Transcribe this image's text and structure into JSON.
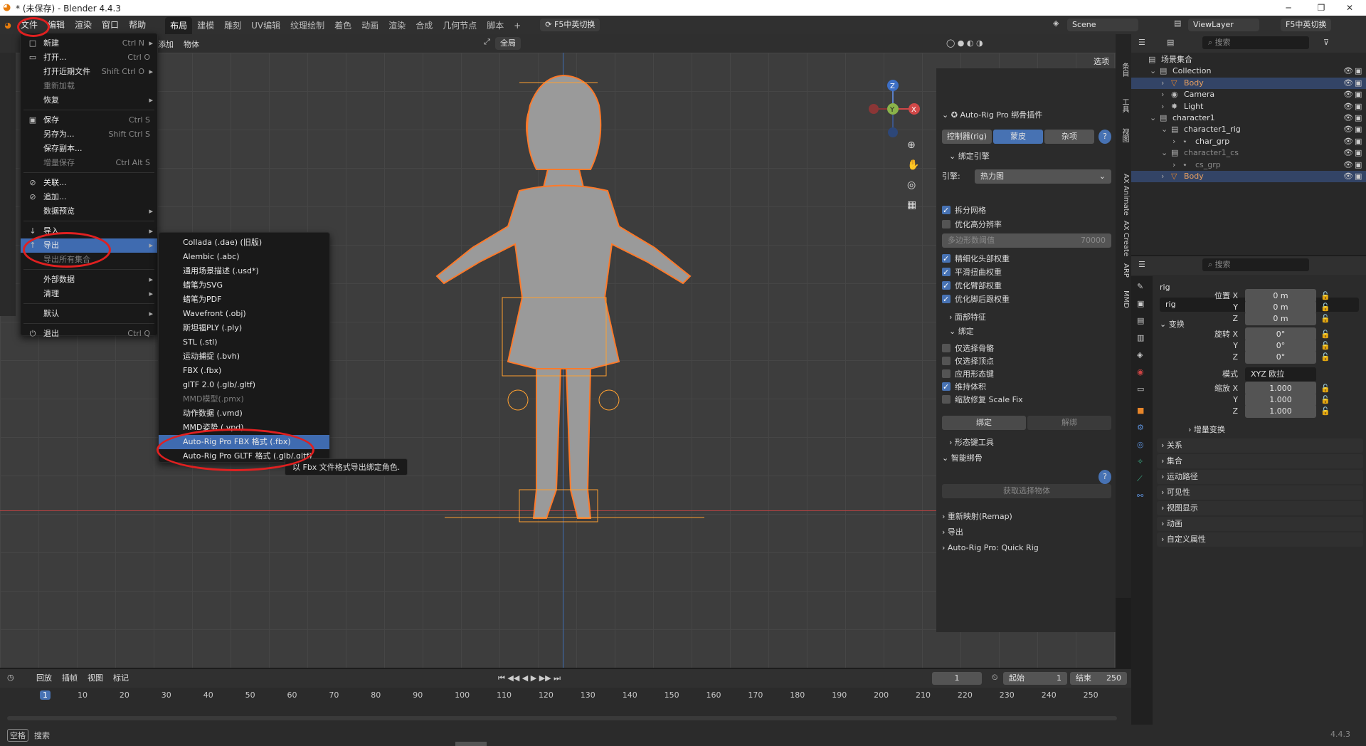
{
  "window": {
    "title": "* (未保存) - Blender 4.4.3",
    "minimize": "─",
    "maximize": "❐",
    "close": "✕"
  },
  "topmenu": [
    "文件",
    "编辑",
    "渲染",
    "窗口",
    "帮助"
  ],
  "workspaces": [
    "布局",
    "建模",
    "雕刻",
    "UV编辑",
    "纹理绘制",
    "着色",
    "动画",
    "渲染",
    "合成",
    "几何节点",
    "脚本"
  ],
  "add_ws": "+",
  "ime": "F5中英切换",
  "scene": "Scene",
  "viewlayer": "ViewLayer",
  "ime2": "F5中英切换",
  "viewport_header": {
    "add": "添加",
    "object": "物体",
    "global": "全局",
    "options": "选项"
  },
  "file_menu": [
    {
      "icon": "□",
      "label": "新建",
      "shortcut": "Ctrl N",
      "arrow": "▸"
    },
    {
      "icon": "▭",
      "label": "打开...",
      "shortcut": "Ctrl O"
    },
    {
      "icon": "",
      "label": "打开近期文件",
      "shortcut": "Shift Ctrl O",
      "arrow": "▸"
    },
    {
      "icon": "",
      "label": "重新加载",
      "shortcut": "",
      "disabled": true
    },
    {
      "icon": "",
      "label": "恢复",
      "shortcut": "",
      "arrow": "▸"
    },
    {
      "icon": "▣",
      "label": "保存",
      "shortcut": "Ctrl S"
    },
    {
      "icon": "",
      "label": "另存为...",
      "shortcut": "Shift Ctrl S"
    },
    {
      "icon": "",
      "label": "保存副本...",
      "shortcut": ""
    },
    {
      "icon": "",
      "label": "增量保存",
      "shortcut": "Ctrl Alt S",
      "disabled": true
    },
    {
      "icon": "⊘",
      "label": "关联...",
      "shortcut": ""
    },
    {
      "icon": "⊘",
      "label": "追加...",
      "shortcut": ""
    },
    {
      "icon": "",
      "label": "数据预览",
      "shortcut": "",
      "arrow": "▸"
    },
    {
      "icon": "↓",
      "label": "导入",
      "shortcut": "",
      "arrow": "▸"
    },
    {
      "icon": "↑",
      "label": "导出",
      "shortcut": "",
      "arrow": "▸",
      "highlight": true
    },
    {
      "icon": "",
      "label": "导出所有集合",
      "shortcut": "",
      "disabled": true
    },
    {
      "icon": "",
      "label": "外部数据",
      "shortcut": "",
      "arrow": "▸"
    },
    {
      "icon": "",
      "label": "清理",
      "shortcut": "",
      "arrow": "▸"
    },
    {
      "icon": "",
      "label": "默认",
      "shortcut": "",
      "arrow": "▸"
    },
    {
      "icon": "⏻",
      "label": "退出",
      "shortcut": "Ctrl Q"
    }
  ],
  "export_menu": [
    {
      "label": "Collada (.dae) (旧版)"
    },
    {
      "label": "Alembic (.abc)"
    },
    {
      "label": "通用场景描述 (.usd*)"
    },
    {
      "label": "蜡笔为SVG"
    },
    {
      "label": "蜡笔为PDF"
    },
    {
      "label": "Wavefront (.obj)"
    },
    {
      "label": "斯坦福PLY (.ply)"
    },
    {
      "label": "STL (.stl)"
    },
    {
      "label": "运动捕捉 (.bvh)"
    },
    {
      "label": "FBX (.fbx)"
    },
    {
      "label": "glTF 2.0 (.glb/.gltf)"
    },
    {
      "label": "MMD模型(.pmx)",
      "disabled": true
    },
    {
      "label": "动作数据 (.vmd)"
    },
    {
      "label": "MMD姿势 (.vpd)"
    },
    {
      "label": "Auto-Rig Pro FBX 格式 (.fbx)",
      "highlight": true
    },
    {
      "label": "Auto-Rig Pro GLTF 格式 (.glb/.gltf)"
    }
  ],
  "tooltip": "以 Fbx 文件格式导出绑定角色.",
  "arp": {
    "title": "Auto-Rig Pro 绑骨插件",
    "tabs": [
      "控制器(rig)",
      "蒙皮",
      "杂项"
    ],
    "help": "?",
    "bind_engine": "绑定引擎",
    "engine_label": "引擎:",
    "engine_value": "热力图",
    "checks1": [
      {
        "label": "拆分网格",
        "on": true
      },
      {
        "label": "优化高分辨率",
        "on": false
      }
    ],
    "poly_label": "多边形数阈值",
    "poly_value": "70000",
    "checks2": [
      {
        "label": "精细化头部权重",
        "on": true
      },
      {
        "label": "平滑扭曲权重",
        "on": true
      },
      {
        "label": "优化臂部权重",
        "on": true
      },
      {
        "label": "优化脚后跟权重",
        "on": true
      }
    ],
    "face": "面部特征",
    "bind": "绑定",
    "checks3": [
      {
        "label": "仅选择骨骼",
        "on": false
      },
      {
        "label": "仅选择顶点",
        "on": false
      },
      {
        "label": "应用形态键",
        "on": false
      },
      {
        "label": "维持体积",
        "on": true
      },
      {
        "label": "缩放修复 Scale Fix",
        "on": false
      }
    ],
    "bind_btn": "绑定",
    "unbind_btn": "解绑",
    "shape_tools": "形态键工具",
    "smart": "智能绑骨",
    "get_sel": "获取选择物体",
    "remap": "重新映射(Remap)",
    "export": "导出",
    "quick": "Auto-Rig Pro: Quick Rig"
  },
  "vtabs": [
    "条目",
    "工具",
    "视图",
    "AX Animate",
    "AX Create",
    "ARP",
    "MMD"
  ],
  "outliner": {
    "search": "搜索",
    "rows": [
      {
        "indent": 0,
        "label": "场景集合",
        "icon": "▤"
      },
      {
        "indent": 1,
        "label": "Collection",
        "icon": "▤",
        "arrow": "⌄"
      },
      {
        "indent": 2,
        "label": "Body",
        "icon": "▽",
        "arrow": "›",
        "sel": true,
        "orange": true
      },
      {
        "indent": 2,
        "label": "Camera",
        "icon": "◉",
        "arrow": "›"
      },
      {
        "indent": 2,
        "label": "Light",
        "icon": "✸",
        "arrow": "›"
      },
      {
        "indent": 1,
        "label": "character1",
        "icon": "▤",
        "arrow": "⌄"
      },
      {
        "indent": 2,
        "label": "character1_rig",
        "icon": "▤",
        "arrow": "⌄"
      },
      {
        "indent": 3,
        "label": "char_grp",
        "icon": "⋆",
        "arrow": "›"
      },
      {
        "indent": 2,
        "label": "character1_cs",
        "icon": "▤",
        "arrow": "⌄",
        "dim": true
      },
      {
        "indent": 3,
        "label": "cs_grp",
        "icon": "⋆",
        "arrow": "›",
        "dim": true
      },
      {
        "indent": 2,
        "label": "Body",
        "icon": "▽",
        "arrow": "›",
        "sel": true,
        "orange": true
      }
    ]
  },
  "props": {
    "search": "搜索",
    "obj": "rig",
    "obj2": "rig",
    "transform": "变换",
    "loc": "位置 X",
    "y": "Y",
    "z": "Z",
    "rot": "旋转 X",
    "mode_label": "模式",
    "mode": "XYZ 欧拉",
    "scale": "缩放 X",
    "loc_vals": [
      "0 m",
      "0 m",
      "0 m"
    ],
    "rot_vals": [
      "0°",
      "0°",
      "0°"
    ],
    "scale_vals": [
      "1.000",
      "1.000",
      "1.000"
    ],
    "delta": "增量变换",
    "sections": [
      "关系",
      "集合",
      "运动路径",
      "可见性",
      "视图显示",
      "动画",
      "自定义属性"
    ]
  },
  "timeline": {
    "menus": [
      "回放",
      "插帧",
      "视图",
      "标记"
    ],
    "frame": "1",
    "start_label": "起始",
    "start": "1",
    "end_label": "结束",
    "end": "250",
    "ticks": [
      "1",
      "10",
      "20",
      "30",
      "40",
      "50",
      "60",
      "70",
      "80",
      "90",
      "100",
      "110",
      "120",
      "130",
      "140",
      "150",
      "160",
      "170",
      "180",
      "190",
      "200",
      "210",
      "220",
      "230",
      "240",
      "250"
    ]
  },
  "status": {
    "key": "空格",
    "action": "搜索",
    "version": "4.4.3"
  }
}
